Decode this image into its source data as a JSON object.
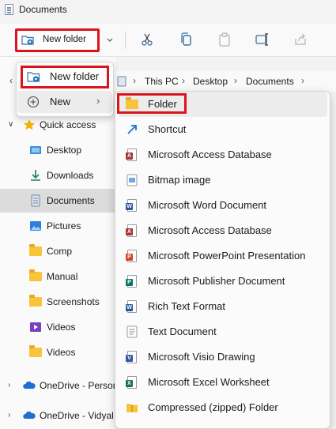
{
  "window": {
    "title": "Documents"
  },
  "toolbar": {
    "new_folder_label": "New folder",
    "icons": [
      "cut-icon",
      "copy-icon",
      "paste-icon",
      "rename-icon",
      "share-icon"
    ]
  },
  "address": {
    "path": [
      "This PC",
      "Desktop",
      "Documents"
    ]
  },
  "context_menu": {
    "new_folder_label": "New folder",
    "new_label": "New"
  },
  "submenu": {
    "items": [
      {
        "label": "Folder",
        "icon": "folder-icon"
      },
      {
        "label": "Shortcut",
        "icon": "shortcut-icon"
      },
      {
        "label": "Microsoft Access Database",
        "icon": "access-icon"
      },
      {
        "label": "Bitmap image",
        "icon": "bitmap-icon"
      },
      {
        "label": "Microsoft Word Document",
        "icon": "word-icon"
      },
      {
        "label": "Microsoft Access Database",
        "icon": "access-icon"
      },
      {
        "label": "Microsoft PowerPoint Presentation",
        "icon": "powerpoint-icon"
      },
      {
        "label": "Microsoft Publisher Document",
        "icon": "publisher-icon"
      },
      {
        "label": "Rich Text Format",
        "icon": "rtf-icon"
      },
      {
        "label": "Text Document",
        "icon": "text-icon"
      },
      {
        "label": "Microsoft Visio Drawing",
        "icon": "visio-icon"
      },
      {
        "label": "Microsoft Excel Worksheet",
        "icon": "excel-icon"
      },
      {
        "label": "Compressed (zipped) Folder",
        "icon": "zip-icon"
      }
    ]
  },
  "nav": {
    "quick_access": "Quick access",
    "items": [
      {
        "label": "Desktop",
        "icon": "desktop-icon"
      },
      {
        "label": "Downloads",
        "icon": "downloads-icon"
      },
      {
        "label": "Documents",
        "icon": "documents-icon"
      },
      {
        "label": "Pictures",
        "icon": "pictures-icon"
      },
      {
        "label": "Comp",
        "icon": "folder-icon"
      },
      {
        "label": "Manual",
        "icon": "folder-icon"
      },
      {
        "label": "Screenshots",
        "icon": "folder-icon"
      },
      {
        "label": "Videos",
        "icon": "videos-icon"
      },
      {
        "label": "Videos",
        "icon": "folder-icon"
      }
    ],
    "onedrive_1": "OneDrive - Person",
    "onedrive_2": "OneDrive - Vidyal"
  },
  "colors": {
    "highlight_border": "#d9151c",
    "accent": "#0067c0",
    "folder": "#f8c43a"
  }
}
